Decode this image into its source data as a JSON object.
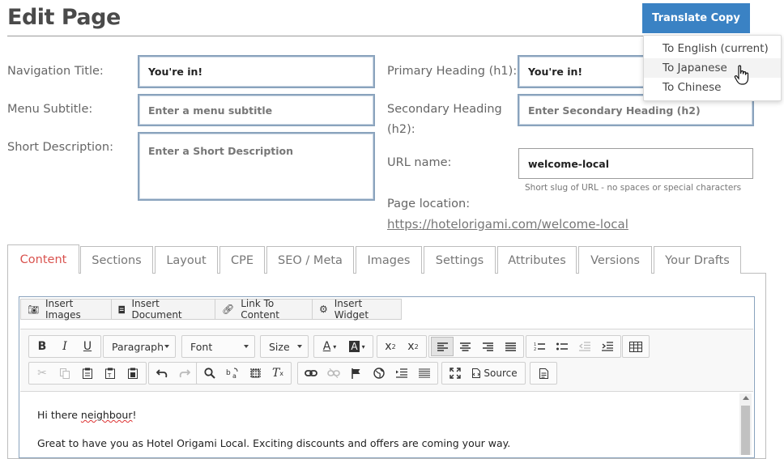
{
  "page": {
    "title": "Edit Page",
    "translate_label": "Translate Copy",
    "translate_menu": [
      "To English (current)",
      "To Japanese",
      "To Chinese"
    ]
  },
  "form": {
    "nav_title_label": "Navigation Title:",
    "nav_title_value": "You're in!",
    "menu_subtitle_label": "Menu Subtitle:",
    "menu_subtitle_placeholder": "Enter a menu subtitle",
    "short_desc_label": "Short Description:",
    "short_desc_placeholder": "Enter a Short Description",
    "h1_label": "Primary Heading (h1):",
    "h1_value": "You're in!",
    "h2_label_1": "Secondary Heading",
    "h2_label_2": "(h2):",
    "h2_placeholder": "Enter Secondary Heading (h2)",
    "url_label": "URL name:",
    "url_value": "welcome-local",
    "url_hint": "Short slug of URL - no spaces or special characters",
    "location_label": "Page location:",
    "location_link": "https://hotelorigami.com/welcome-local"
  },
  "tabs": [
    "Content",
    "Sections",
    "Layout",
    "CPE",
    "SEO / Meta",
    "Images",
    "Settings",
    "Attributes",
    "Versions",
    "Your Drafts"
  ],
  "insert_buttons": [
    "Insert Images",
    "Insert Document",
    "Link To Content",
    "Insert Widget"
  ],
  "toolbar": {
    "paragraph": "Paragraph",
    "font": "Font",
    "size": "Size",
    "source": "Source"
  },
  "editor": {
    "line1_a": "Hi there ",
    "line1_b": "neighbour",
    "line1_c": "!",
    "line2": "Great to have you as Hotel Origami Local. Exciting discounts and offers are coming your way."
  },
  "colors": {
    "accent": "#3a82c4",
    "active_tab": "#d9534f",
    "field_border": "#8aa3bd"
  }
}
